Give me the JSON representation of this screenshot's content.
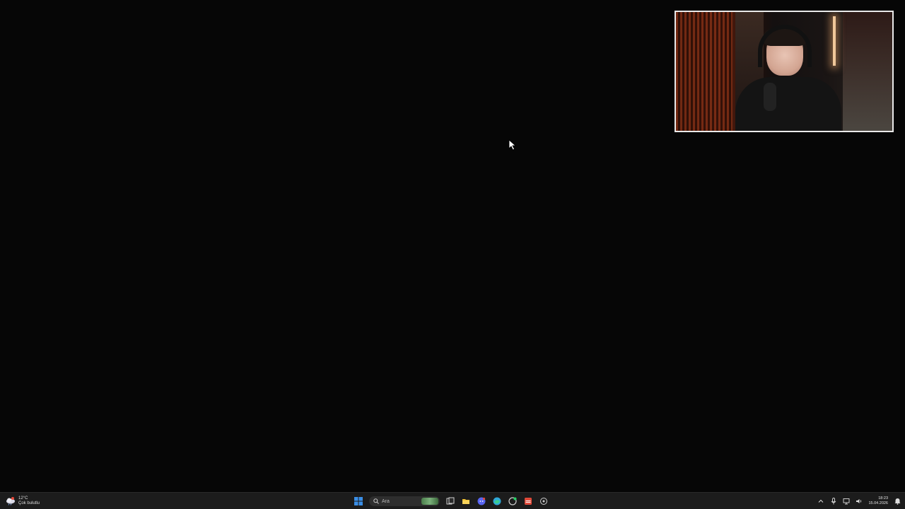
{
  "weather": {
    "temperature": "12°C",
    "condition": "Çok bulutlu",
    "icon": "cloud-rain-icon"
  },
  "taskbar": {
    "search_placeholder": "Ara",
    "pinned": [
      {
        "name": "start-icon",
        "color": "#3a8ee6"
      },
      {
        "name": "task-view-icon",
        "color": "#cfcfcf"
      },
      {
        "name": "file-explorer-icon",
        "color": "#f2c233"
      },
      {
        "name": "discord-icon",
        "color": "#5865f2"
      },
      {
        "name": "edge-icon",
        "color": "#2fa9d8"
      },
      {
        "name": "whatsapp-icon",
        "color": "#25d366"
      },
      {
        "name": "stream-app-icon",
        "color": "#e04a3a"
      },
      {
        "name": "settings-icon",
        "color": "#cfcfcf"
      }
    ]
  },
  "tray": {
    "time": "18:23",
    "date": "15.04.2026"
  },
  "colors": {
    "desktop_bg": "#060606",
    "taskbar_bg": "#1c1c1c",
    "webcam_border": "#e9e9e9"
  }
}
